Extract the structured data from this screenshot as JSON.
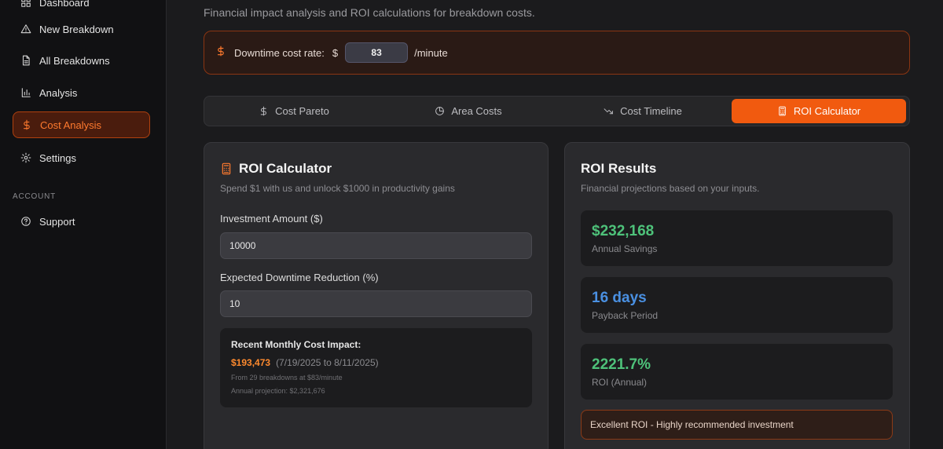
{
  "sidebar": {
    "items": [
      {
        "label": "Dashboard",
        "icon": "dashboard-icon"
      },
      {
        "label": "New Breakdown",
        "icon": "warning-icon"
      },
      {
        "label": "All Breakdowns",
        "icon": "document-icon"
      },
      {
        "label": "Analysis",
        "icon": "bar-chart-icon"
      },
      {
        "label": "Cost Analysis",
        "icon": "dollar-icon"
      },
      {
        "label": "Settings",
        "icon": "gear-icon"
      }
    ],
    "section_label": "ACCOUNT",
    "support_label": "Support"
  },
  "header": {
    "subtitle": "Financial impact analysis and ROI calculations for breakdown costs."
  },
  "rate": {
    "label": "Downtime cost rate:",
    "currency": "$",
    "value": "83",
    "unit": "/minute"
  },
  "tabs": [
    {
      "label": "Cost Pareto",
      "icon": "dollar-icon"
    },
    {
      "label": "Area Costs",
      "icon": "pie-chart-icon"
    },
    {
      "label": "Cost Timeline",
      "icon": "trend-down-icon"
    },
    {
      "label": "ROI Calculator",
      "icon": "calculator-icon",
      "active": true
    }
  ],
  "calculator": {
    "title": "ROI Calculator",
    "subtitle": "Spend $1 with us and unlock $1000 in productivity gains",
    "investment_label": "Investment Amount ($)",
    "investment_value": "10000",
    "reduction_label": "Expected Downtime Reduction (%)",
    "reduction_value": "10",
    "impact": {
      "title": "Recent Monthly Cost Impact:",
      "amount": "$193,473",
      "range": "(7/19/2025 to 8/11/2025)",
      "from_note": "From 29 breakdowns at $83/minute",
      "annual_note": "Annual projection: $2,321,676"
    }
  },
  "results": {
    "title": "ROI Results",
    "subtitle": "Financial projections based on your inputs.",
    "items": [
      {
        "value": "$232,168",
        "label": "Annual Savings",
        "color": "#4ec27a"
      },
      {
        "value": "16 days",
        "label": "Payback Period",
        "color": "#4a90e2"
      },
      {
        "value": "2221.7%",
        "label": "ROI (Annual)",
        "color": "#4ec27a"
      }
    ],
    "verdict": "Excellent ROI - Highly recommended investment"
  },
  "colors": {
    "accent": "#f15a0f",
    "sidebar_bg": "#111113",
    "page_bg": "#1b1b1d"
  }
}
